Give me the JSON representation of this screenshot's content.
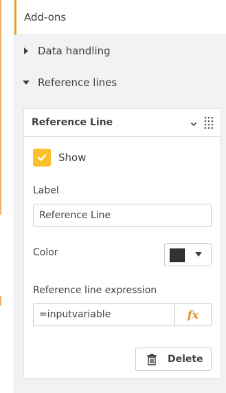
{
  "addons": {
    "title": "Add-ons"
  },
  "sections": {
    "data_handling": {
      "label": "Data handling",
      "expanded": false
    },
    "reference_lines": {
      "label": "Reference lines",
      "expanded": true
    }
  },
  "reference_line": {
    "title": "Reference Line",
    "show": {
      "label": "Show",
      "checked": true
    },
    "label_field": {
      "label": "Label",
      "value": "Reference Line"
    },
    "color_field": {
      "label": "Color",
      "value": "#333333"
    },
    "expression_field": {
      "label": "Reference line expression",
      "value": "=inputvariable",
      "fx_label": "fx"
    },
    "delete_label": "Delete"
  },
  "colors": {
    "accent": "#f0a038",
    "checkbox": "#fcc02a",
    "fx": "#e08c25",
    "swatch": "#333333"
  },
  "icons": {
    "collapsed_arrow": "caret-right-icon",
    "expanded_arrow": "caret-down-icon",
    "card_chevron": "chevron-down-icon",
    "drag_handle": "drag-handle-icon",
    "check": "check-icon",
    "color_dropdown": "caret-down-icon",
    "delete": "trash-icon"
  }
}
